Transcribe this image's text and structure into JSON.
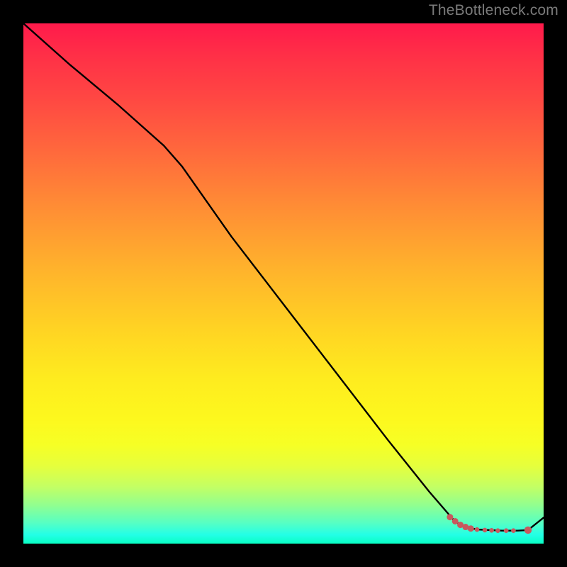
{
  "watermark": "TheBottleneck.com",
  "chart_data": {
    "type": "line",
    "title": "",
    "xlabel": "",
    "ylabel": "",
    "xlim": [
      0,
      100
    ],
    "ylim": [
      0,
      100
    ],
    "grid": false,
    "legend": false,
    "series": [
      {
        "name": "curve",
        "color": "#000000",
        "x": [
          0,
          9,
          18,
          27,
          30.5,
          40,
          50,
          60,
          70,
          78,
          83,
          85.5,
          87.5,
          92,
          95,
          97,
          100
        ],
        "y": [
          100,
          92,
          84.5,
          76.5,
          72.5,
          59,
          46,
          33,
          20,
          10,
          4.2,
          3.0,
          2.7,
          2.5,
          2.5,
          2.6,
          5
        ]
      }
    ],
    "markers": {
      "color": "#c8595e",
      "stroke": "#c8595e",
      "points": [
        {
          "x": 82.0,
          "y": 5.1,
          "r": 4.5
        },
        {
          "x": 83.0,
          "y": 4.3,
          "r": 4.5
        },
        {
          "x": 84.0,
          "y": 3.6,
          "r": 4.5
        },
        {
          "x": 85.0,
          "y": 3.2,
          "r": 4.5
        },
        {
          "x": 86.0,
          "y": 2.9,
          "r": 4.5
        },
        {
          "x": 87.2,
          "y": 2.7,
          "r": 3.3
        },
        {
          "x": 88.7,
          "y": 2.6,
          "r": 3.3
        },
        {
          "x": 90.0,
          "y": 2.55,
          "r": 3.3
        },
        {
          "x": 91.2,
          "y": 2.5,
          "r": 3.3
        },
        {
          "x": 92.8,
          "y": 2.5,
          "r": 3.3
        },
        {
          "x": 94.2,
          "y": 2.5,
          "r": 3.3
        },
        {
          "x": 97.0,
          "y": 2.6,
          "r": 5.2
        }
      ]
    },
    "gradient_stops": [
      {
        "pos": 0.0,
        "color": "#ff1a4b"
      },
      {
        "pos": 0.35,
        "color": "#ff8c35"
      },
      {
        "pos": 0.68,
        "color": "#feeb1f"
      },
      {
        "pos": 0.88,
        "color": "#c4ff63"
      },
      {
        "pos": 1.0,
        "color": "#09ffc4"
      }
    ]
  }
}
